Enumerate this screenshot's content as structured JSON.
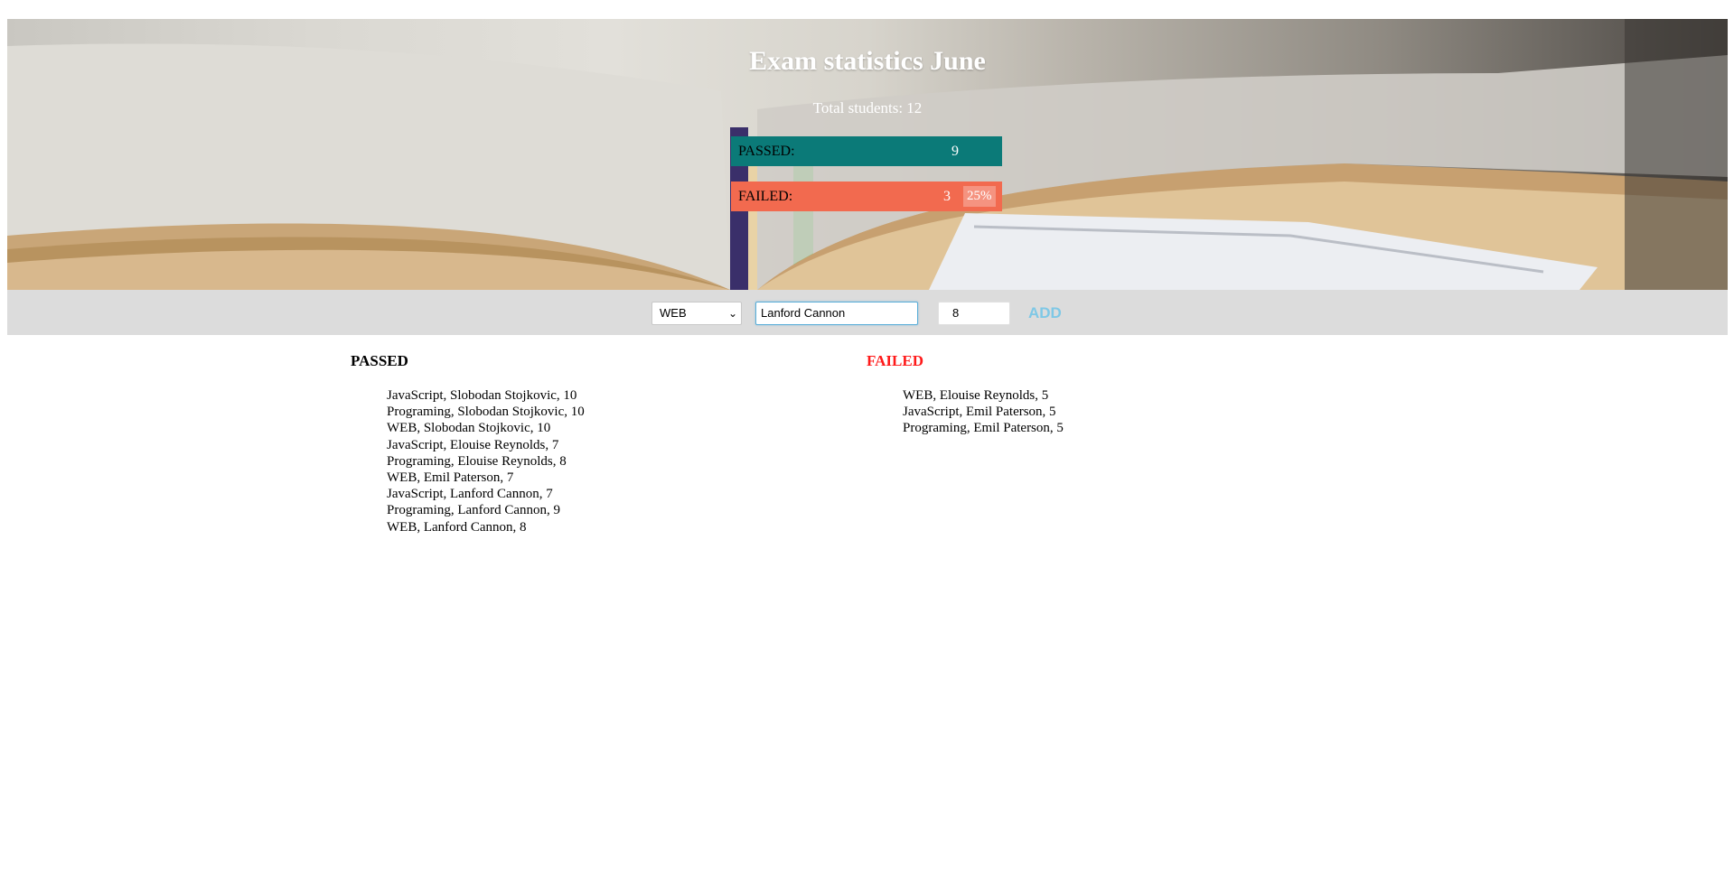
{
  "header": {
    "title": "Exam statistics June",
    "total_students": "Total students: 12"
  },
  "stats": {
    "passed": {
      "label": "PASSED:",
      "count": "9",
      "color": "#0b7a78"
    },
    "failed": {
      "label": "FAILED:",
      "count": "3",
      "percent": "25%",
      "color": "#f26a4f"
    }
  },
  "form": {
    "subject_value": "WEB",
    "name_value": "Lanford Cannon",
    "grade_value": "8",
    "add_label": "ADD",
    "add_color": "#7ec8e6"
  },
  "lists": {
    "passed": {
      "heading": "PASSED",
      "items": [
        "JavaScript, Slobodan Stojkovic, 10",
        "Programing, Slobodan Stojkovic, 10",
        "WEB, Slobodan Stojkovic, 10",
        "JavaScript, Elouise Reynolds, 7",
        "Programing, Elouise Reynolds, 8",
        "WEB, Emil Paterson, 7",
        "JavaScript, Lanford Cannon, 7",
        "Programing, Lanford Cannon, 9",
        "WEB, Lanford Cannon, 8"
      ]
    },
    "failed": {
      "heading": "FAILED",
      "heading_color": "#ff1a1a",
      "items": [
        "WEB, Elouise Reynolds, 5",
        "JavaScript, Emil Paterson, 5",
        "Programing, Emil Paterson, 5"
      ]
    }
  }
}
